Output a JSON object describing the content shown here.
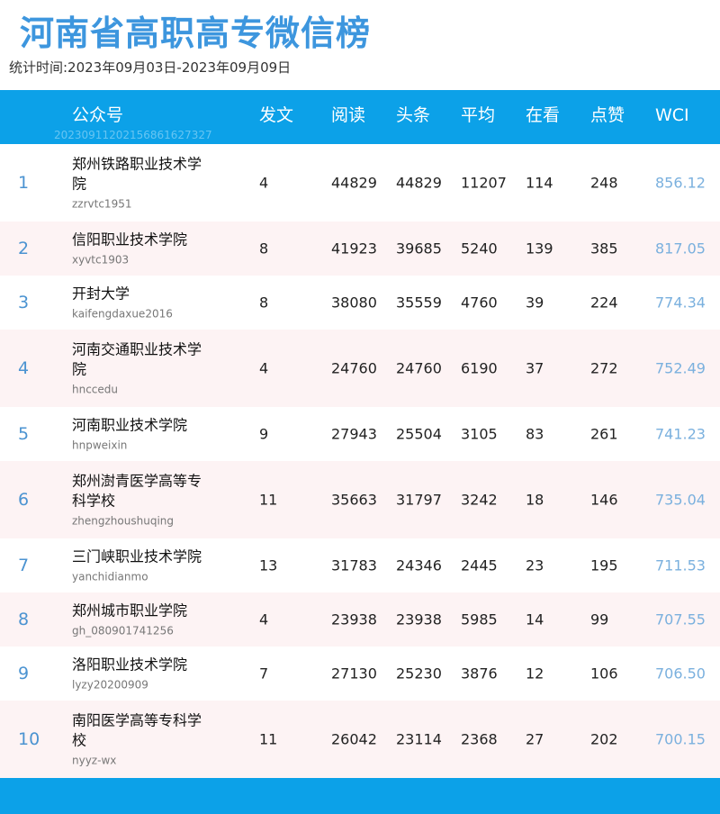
{
  "title": "河南省高职高专微信榜",
  "period": "统计时间:2023年09月03日-2023年09月09日",
  "header": {
    "account": "公众号",
    "posts": "发文",
    "reads": "阅读",
    "headline": "头条",
    "average": "平均",
    "watching": "在看",
    "likes": "点赞",
    "wci": "WCI",
    "stamp": "20230911202156861627327"
  },
  "rows": [
    {
      "rank": "1",
      "name": "郑州铁路职业技术学院",
      "account": "zzrvtc1951",
      "posts": "4",
      "reads": "44829",
      "headline": "44829",
      "average": "11207",
      "watching": "114",
      "likes": "248",
      "wci": "856.12"
    },
    {
      "rank": "2",
      "name": "信阳职业技术学院",
      "account": "xyvtc1903",
      "posts": "8",
      "reads": "41923",
      "headline": "39685",
      "average": "5240",
      "watching": "139",
      "likes": "385",
      "wci": "817.05"
    },
    {
      "rank": "3",
      "name": "开封大学",
      "account": "kaifengdaxue2016",
      "posts": "8",
      "reads": "38080",
      "headline": "35559",
      "average": "4760",
      "watching": "39",
      "likes": "224",
      "wci": "774.34"
    },
    {
      "rank": "4",
      "name": "河南交通职业技术学院",
      "account": "hnccedu",
      "posts": "4",
      "reads": "24760",
      "headline": "24760",
      "average": "6190",
      "watching": "37",
      "likes": "272",
      "wci": "752.49"
    },
    {
      "rank": "5",
      "name": "河南职业技术学院",
      "account": "hnpweixin",
      "posts": "9",
      "reads": "27943",
      "headline": "25504",
      "average": "3105",
      "watching": "83",
      "likes": "261",
      "wci": "741.23"
    },
    {
      "rank": "6",
      "name": "郑州澍青医学高等专科学校",
      "account": "zhengzhoushuqing",
      "posts": "11",
      "reads": "35663",
      "headline": "31797",
      "average": "3242",
      "watching": "18",
      "likes": "146",
      "wci": "735.04"
    },
    {
      "rank": "7",
      "name": "三门峡职业技术学院",
      "account": "yanchidianmo",
      "posts": "13",
      "reads": "31783",
      "headline": "24346",
      "average": "2445",
      "watching": "23",
      "likes": "195",
      "wci": "711.53"
    },
    {
      "rank": "8",
      "name": "郑州城市职业学院",
      "account": "gh_080901741256",
      "posts": "4",
      "reads": "23938",
      "headline": "23938",
      "average": "5985",
      "watching": "14",
      "likes": "99",
      "wci": "707.55"
    },
    {
      "rank": "9",
      "name": "洛阳职业技术学院",
      "account": "lyzy20200909",
      "posts": "7",
      "reads": "27130",
      "headline": "25230",
      "average": "3876",
      "watching": "12",
      "likes": "106",
      "wci": "706.50"
    },
    {
      "rank": "10",
      "name": "南阳医学高等专科学校",
      "account": "nyyz-wx",
      "posts": "11",
      "reads": "26042",
      "headline": "23114",
      "average": "2368",
      "watching": "27",
      "likes": "202",
      "wci": "700.15"
    }
  ]
}
